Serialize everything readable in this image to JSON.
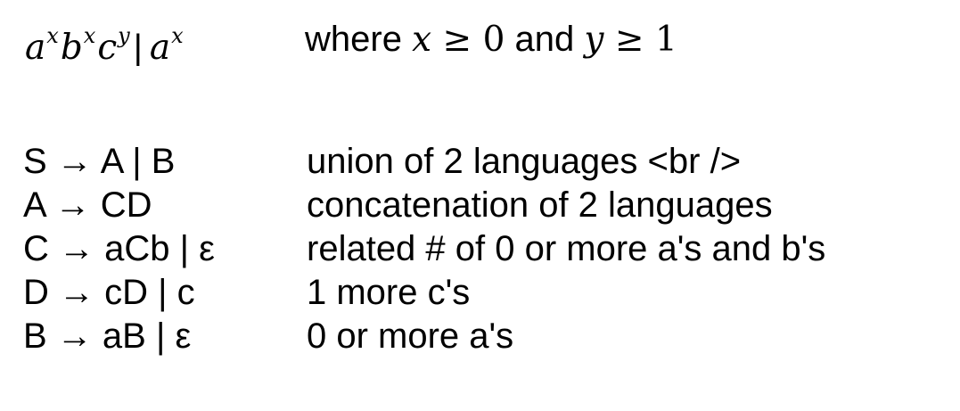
{
  "heading": {
    "expr": {
      "terms": [
        {
          "base": "a",
          "sup": "x"
        },
        {
          "base": "b",
          "sup": "x"
        },
        {
          "base": "c",
          "sup": "y"
        }
      ],
      "separator": "|",
      "alt": {
        "base": "a",
        "sup": "x"
      }
    },
    "condition": {
      "where": "where",
      "var1": "x",
      "rel1": "≥",
      "num1": "0",
      "and": "and",
      "var2": "y",
      "rel2": "≥",
      "num2": "1"
    }
  },
  "rules": [
    {
      "production": "S → A | B",
      "description": "union of 2 languages <br />"
    },
    {
      "production": "A → CD",
      "description": "concatenation of 2 languages"
    },
    {
      "production": "C → aCb | ε",
      "description": "related # of 0 or more a's and b's"
    },
    {
      "production": "D → cD | c",
      "description": "1 more c's"
    },
    {
      "production": "B → aB | ε",
      "description": "0 or more a's"
    }
  ]
}
